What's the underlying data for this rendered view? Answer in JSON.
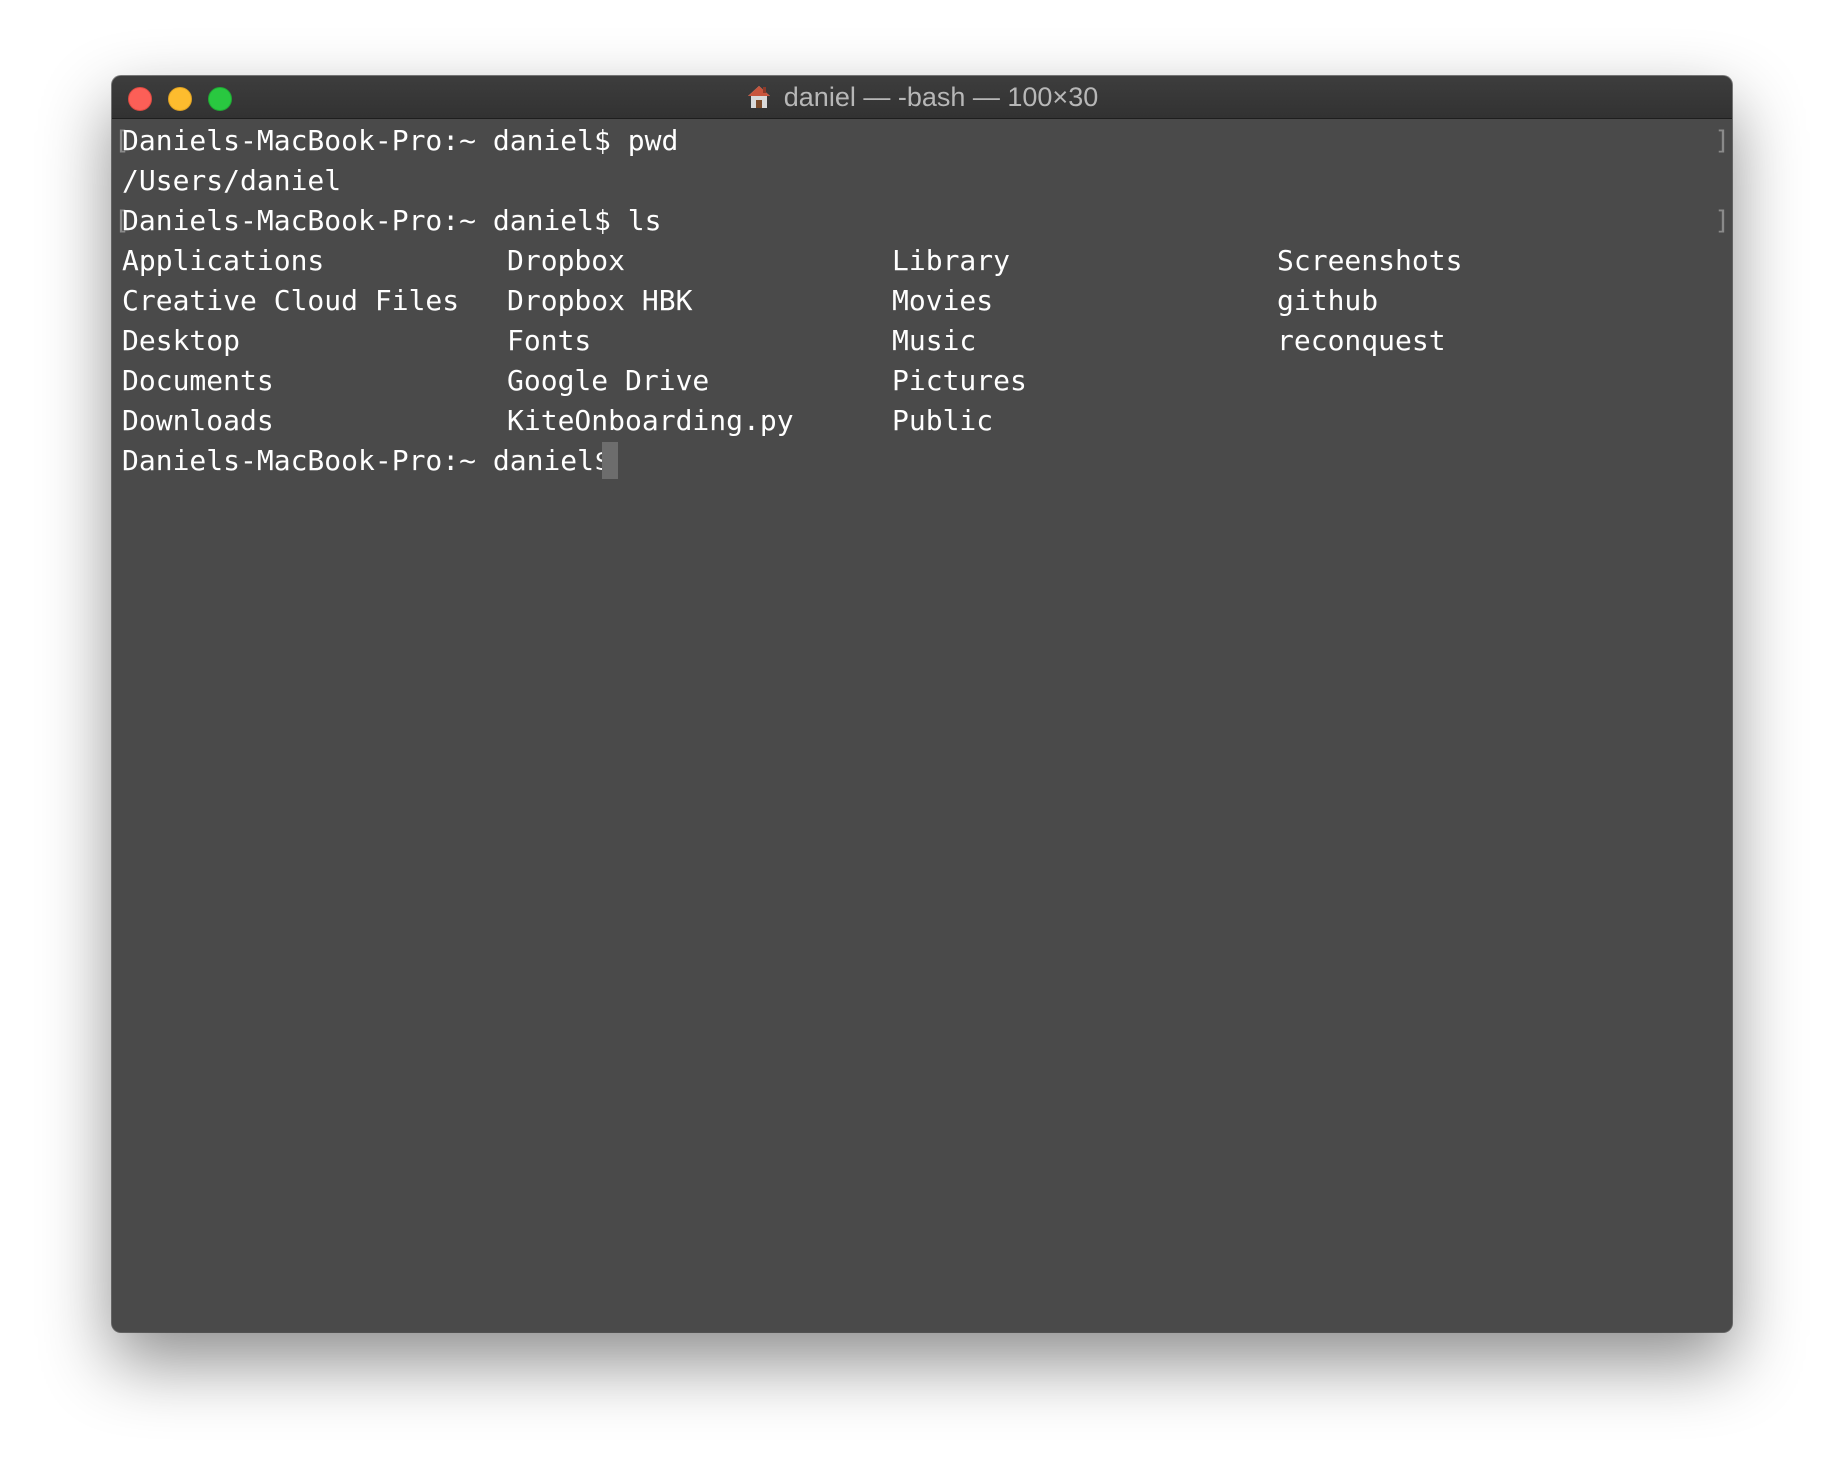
{
  "window": {
    "title": "daniel — -bash — 100×30",
    "title_icon": "home-icon"
  },
  "colors": {
    "background": "#4a4a4a",
    "text": "#ffffff",
    "titlebar": "#383838",
    "close": "#fc5f57",
    "minimize": "#fdbc2e",
    "zoom": "#29c840"
  },
  "terminal": {
    "line1": "Daniels-MacBook-Pro:~ daniel$ pwd",
    "line2": "/Users/daniel",
    "line3": "Daniels-MacBook-Pro:~ daniel$ ls",
    "prompt": "Daniels-MacBook-Pro:~ daniel$ ",
    "ls_columns": [
      [
        "Applications",
        "Creative Cloud Files",
        "Desktop",
        "Documents",
        "Downloads"
      ],
      [
        "Dropbox",
        "Dropbox HBK",
        "Fonts",
        "Google Drive",
        "KiteOnboarding.py"
      ],
      [
        "Library",
        "Movies",
        "Music",
        "Pictures",
        "Public"
      ],
      [
        "Screenshots",
        "github",
        "reconquest"
      ]
    ],
    "mark_open": "[",
    "mark_close": "]"
  }
}
